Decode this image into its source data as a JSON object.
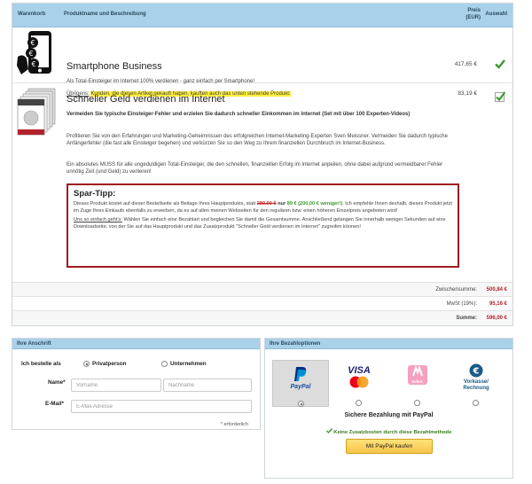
{
  "table_header": {
    "cart": "Warenkorb",
    "name": "Produktname und Beschreibung",
    "price_line1": "Preis",
    "price_line2": "(EUR)",
    "selection": "Auswahl"
  },
  "products": [
    {
      "title": "Smartphone Business",
      "price": "417,65 €",
      "description": "Als Total-Einsteiger im Internet 100% verdienen - ganz einfach per Smartphone!",
      "note_label": "Übrigens:",
      "note_text": "Kunden, die diesen Artikel gekauft haben, kauften auch das unten stehende Produkt:",
      "image_icon": "smartphone-euro-icon",
      "selected": true
    },
    {
      "title": "Schneller Geld verdienen im Internet",
      "price": "83,19 €",
      "bold_intro": "Vermeiden Sie typische Einsteiger-Fehler und erzielen Sie dadurch schneller Einkommen im Internet (Set mit über 100 Experten-Videos)",
      "para1": "Profitieren Sie von den Erfahrungen und Marketing-Geheimnissen des erfolgreichen Internet-Marketing-Experten Sven Meissner. Vermeiden Sie dadurch typische Anfängerfehler (die fast alle Einsteiger begehen) und verkürzen Sie so den Weg zu Ihrem finanziellen Durchbruch im Internet-Business.",
      "para2": "Ein absolutes MUSS für alle ungeduldigen Total-Einsteiger, die den schnellen, finanziellen Erfolg im Internet anpeilen, ohne dabei aufgrund vermeidbarer Fehler unnötig Zeit (und Geld) zu verlieren!",
      "image_icon": "product-box-stack-icon",
      "selected": true
    }
  ],
  "tip": {
    "title": "Spar-Tipp:",
    "p1_a": "Dieses Produkt kostet auf dieser Bestellseite als Beilage Ihres Hauptprodukts, statt",
    "old_price": "289,00 €",
    "p1_b": "nur",
    "new_price": "89 € (200,00 € weniger!)",
    "p1_c": ". Ich empfehle Ihnen deshalb, dieses Produkt jetzt im Zuge Ihres Einkaufs ebenfalls zu erwerben, da es auf allen meinen Webseiten für den regulären bzw. einen höheren Einzelpreis angeboten wird!",
    "p2_label": "Uns so einfach geht's:",
    "p2_text": "Wählen Sie einfach eine Bezahlart und begleichen Sie damit die Gesamtsumme. Anschließend gelangen Sie innerhalb weniger Sekunden auf eine Downloadseite, von der Sie auf das Hauptprodukt und das Zusatzprodukt \"Schneller Geld verdienen im Internet\" zugreifen können!"
  },
  "summary": {
    "subtotal_label": "Zwischensumme:",
    "subtotal_value": "500,84 €",
    "tax_label": "MwSt (19%):",
    "tax_value": "95,16 €",
    "total_label": "Summe:",
    "total_value": "596,00 €"
  },
  "address": {
    "header": "Ihre Anschrift",
    "order_as_label": "Ich bestelle als",
    "option_private": "Privatperson",
    "option_company": "Unternehmen",
    "name_label": "Name*",
    "firstname_placeholder": "Vorname",
    "lastname_placeholder": "Nachname",
    "email_label": "E-Mail*",
    "email_placeholder": "E-Mail-Adresse",
    "required_note": "* erforderlich"
  },
  "payment": {
    "header": "Ihre Bezahloptionen",
    "options": [
      {
        "name": "PayPal",
        "icon": "paypal-logo-icon",
        "selected": true
      },
      {
        "name": "VISA",
        "sub": "MasterCard",
        "icon": "credit-card-logos-icon",
        "selected": false
      },
      {
        "name": "Sofort.",
        "icon": "sofort-logo-icon",
        "selected": false
      },
      {
        "name": "Vorkasse/",
        "name2": "Rechnung",
        "icon": "euro-coin-icon",
        "selected": false
      }
    ],
    "title": "Sichere Bezahlung mit PayPal",
    "note": "Keine Zusatzkosten durch diese Bezahlmethode",
    "button_label": "Mit PayPal kaufen"
  },
  "colors": {
    "header_bg": "#a9d1ea",
    "price_red": "#b2222c",
    "tip_border": "#9d1c20",
    "check_green": "#3a9b2a",
    "highlight": "#ffef3a"
  }
}
